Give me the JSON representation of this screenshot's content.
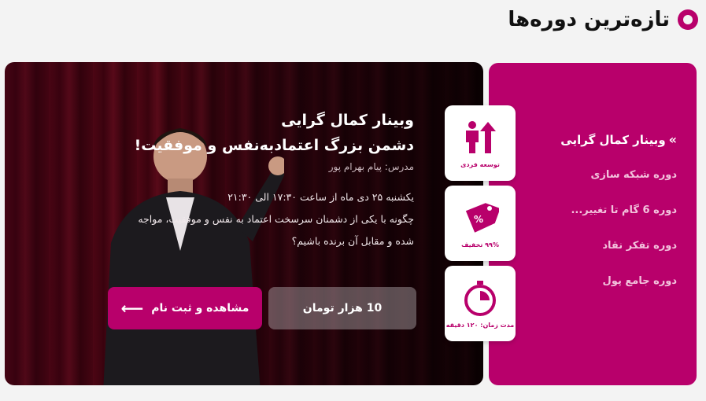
{
  "section": {
    "title": "تازه‌ترین دوره‌ها"
  },
  "nav": {
    "items": [
      {
        "label": "وبینار کمال گرایی",
        "active": true
      },
      {
        "label": "دوره شبکه سازی",
        "active": false
      },
      {
        "label": "دوره 6 گام تا تغییر...",
        "active": false
      },
      {
        "label": "دوره تفکر نقاد",
        "active": false
      },
      {
        "label": "دوره جامع پول",
        "active": false
      }
    ]
  },
  "badges": [
    {
      "label": "توسعه فردی",
      "icon": "growth-icon"
    },
    {
      "label": "۹۹% تخفیف",
      "icon": "discount-tag-icon"
    },
    {
      "label": "مدت زمان: ۱۲۰ دقیقه",
      "icon": "stopwatch-icon"
    }
  ],
  "hero": {
    "title_line1": "وبینار کمال گرایی",
    "title_line2": "دشمن بزرگ اعتمادبه‌نفس و موفقیت!",
    "instructor": "مدرس: پیام بهرام پور",
    "desc_line1": "یکشنبه ۲۵ دی ماه از ساعت ۱۷:۳۰ الی ۲۱:۳۰",
    "desc_line2": "چگونه با یکی از دشمنان سرسخت اعتماد به نفس و موفقیت، مواجه",
    "desc_line3": "شده و مقابل آن برنده باشیم؟",
    "price_label": "10 هزار تومان",
    "register_label": "مشاهده و ثبت نام",
    "register_arrow": "⟵"
  },
  "colors": {
    "accent": "#b8006b",
    "background": "#f3f3f3"
  }
}
